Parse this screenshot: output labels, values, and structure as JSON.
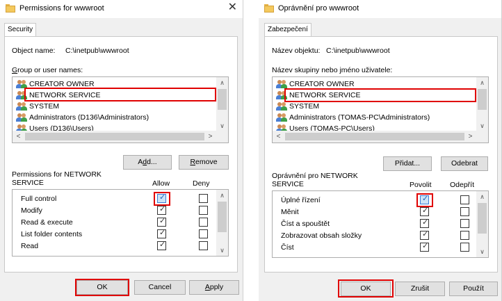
{
  "dialogs": [
    {
      "title": "Permissions for wwwroot",
      "tab": "Security",
      "object_name_label": "Object name:",
      "object_name_value": "C:\\inetpub\\wwwroot",
      "group_label": "Group or user names:",
      "users": [
        "CREATOR OWNER",
        "NETWORK SERVICE",
        "SYSTEM",
        "Administrators (D136\\Administrators)",
        "Users (D136\\Users)"
      ],
      "add_button": "Add...",
      "remove_button": "Remove",
      "permissions_label_line1": "Permissions for NETWORK",
      "permissions_label_line2": "SERVICE",
      "allow_header": "Allow",
      "deny_header": "Deny",
      "permissions": [
        "Full control",
        "Modify",
        "Read & execute",
        "List folder contents",
        "Read"
      ],
      "ok_button": "OK",
      "cancel_button": "Cancel",
      "apply_button": "Apply"
    },
    {
      "title": "Oprávnění pro wwwroot",
      "tab": "Zabezpečení",
      "object_name_label": "Název objektu:",
      "object_name_value": "C:\\inetpub\\wwwroot",
      "group_label": "Název skupiny nebo jméno uživatele:",
      "users": [
        "CREATOR OWNER",
        "NETWORK SERVICE",
        "SYSTEM",
        "Administrators (TOMAS-PC\\Administrators)",
        "Users (TOMAS-PC\\Users)"
      ],
      "add_button": "Přidat...",
      "remove_button": "Odebrat",
      "permissions_label_line1": "Oprávnění pro NETWORK",
      "permissions_label_line2": "SERVICE",
      "allow_header": "Povolit",
      "deny_header": "Odepřít",
      "permissions": [
        "Úplné řízení",
        "Měnit",
        "Číst a spouštět",
        "Zobrazovat obsah složky",
        "Číst"
      ],
      "ok_button": "OK",
      "cancel_button": "Zrušit",
      "apply_button": "Použít"
    }
  ],
  "selected_user": "NETWORK SERVICE",
  "allow_checked": [
    true,
    true,
    true,
    true,
    true
  ],
  "deny_checked": [
    false,
    false,
    false,
    false,
    false
  ],
  "highlight_color": "#e00000"
}
